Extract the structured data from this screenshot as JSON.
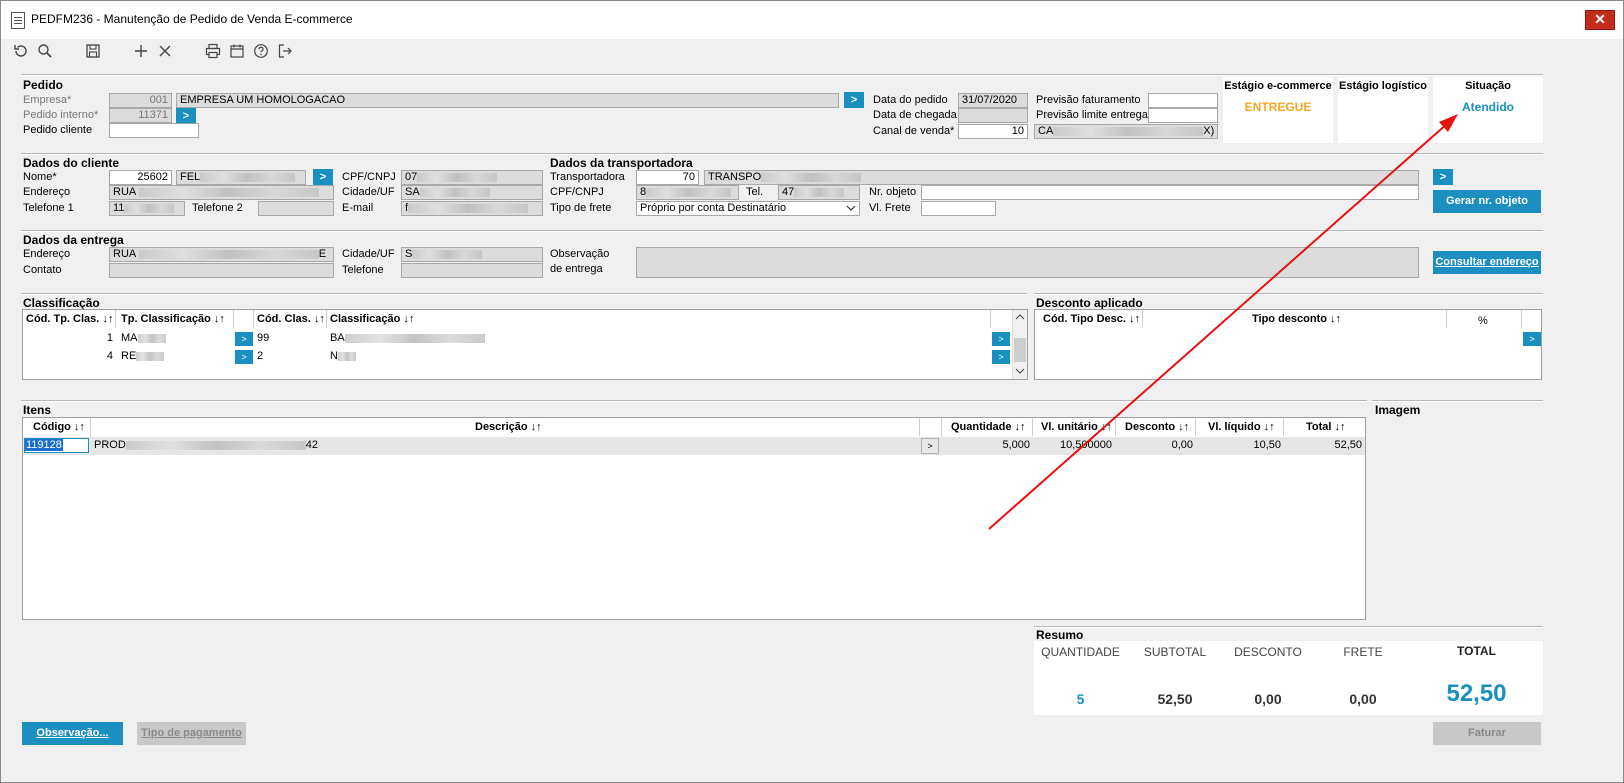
{
  "window": {
    "title": "PEDFM236 - Manutenção de Pedido de Venda E-commerce",
    "close_glyph": "✕"
  },
  "toolbar": {
    "icons": [
      "undo-icon",
      "search-icon",
      "save-icon",
      "add-icon",
      "delete-icon",
      "print-icon",
      "calendar-icon",
      "help-icon",
      "exit-icon"
    ]
  },
  "pedido": {
    "title": "Pedido",
    "empresa_label": "Empresa*",
    "empresa_code": "001",
    "empresa_name": "EMPRESA UM  HOMOLOGACAO",
    "pedido_interno_label": "Pedido interno*",
    "pedido_interno": "11371",
    "pedido_cliente_label": "Pedido cliente",
    "pedido_cliente": "",
    "data_pedido_label": "Data do pedido",
    "data_pedido": "31/07/2020",
    "data_chegada_label": "Data de chegada",
    "data_chegada": "",
    "canal_venda_label": "Canal de venda*",
    "canal_venda_code": "10",
    "canal_venda_name_start": "CA",
    "canal_venda_name_end": "X)",
    "previsao_faturamento_label": "Previsão faturamento",
    "previsao_faturamento": "",
    "previsao_limite_label": "Previsão limite entrega",
    "previsao_limite": ""
  },
  "stages": {
    "ecommerce_label": "Estágio e-commerce",
    "ecommerce_value": "ENTREGUE",
    "logistico_label": "Estágio logístico",
    "logistico_value": "",
    "situacao_label": "Situação",
    "situacao_value": "Atendido"
  },
  "cliente": {
    "title": "Dados do cliente",
    "nome_label": "Nome*",
    "nome_code": "25602",
    "nome_start": "FEL",
    "cpf_label": "CPF/CNPJ",
    "cpf_start": "07",
    "endereco_label": "Endereço",
    "endereco_start": "RUA",
    "cidade_label": "Cidade/UF",
    "cidade_start": "SA",
    "telefone1_label": "Telefone 1",
    "telefone1_start": "11",
    "telefone2_label": "Telefone 2",
    "telefone2": "",
    "email_label": "E-mail",
    "email_start": "f"
  },
  "transportadora": {
    "title": "Dados da transportadora",
    "transportadora_label": "Transportadora",
    "transportadora_code": "70",
    "transportadora_start": "TRANSPO",
    "cpf_label": "CPF/CNPJ",
    "cpf_start": "8",
    "tel_label": "Tel.",
    "tel_start": "47",
    "nr_objeto_label": "Nr. objeto",
    "nr_objeto": "",
    "tipo_frete_label": "Tipo de frete",
    "tipo_frete": "Próprio por conta Destinatário",
    "vl_frete_label": "Vl. Frete",
    "vl_frete": "",
    "gerar_button": "Gerar nr. objeto"
  },
  "entrega": {
    "title": "Dados da entrega",
    "endereco_label": "Endereço",
    "endereco_start": "RUA ",
    "endereco_end": "E",
    "cidade_label": "Cidade/UF",
    "cidade_start": "S",
    "contato_label": "Contato",
    "contato": "",
    "telefone_label": "Telefone",
    "telefone": "",
    "obs_label_1": "Observação",
    "obs_label_2": "de entrega",
    "obs": "",
    "consultar_button": "Consultar endereço"
  },
  "classificacao": {
    "title": "Classificação",
    "headers": [
      "Cód. Tp. Clas. ↓↑",
      "Tp. Classificação ↓↑",
      "Cód. Clas. ↓↑",
      "Classificação ↓↑"
    ],
    "rows": [
      {
        "cod_tp": "1",
        "tp": "MA",
        "cod": "99",
        "clas": "BA"
      },
      {
        "cod_tp": "4",
        "tp": "RE",
        "cod": "2",
        "clas": "N"
      }
    ]
  },
  "desconto": {
    "title": "Desconto aplicado",
    "headers": [
      "Cód. Tipo Desc. ↓↑",
      "Tipo desconto ↓↑",
      "%"
    ]
  },
  "itens": {
    "title": "Itens",
    "imagem_title": "Imagem",
    "headers": [
      "Código ↓↑",
      "Descrição ↓↑",
      "Quantidade ↓↑",
      "Vl. unitário ↓↑",
      "Desconto ↓↑",
      "Vl. líquido ↓↑",
      "Total ↓↑"
    ],
    "rows": [
      {
        "codigo": "119128",
        "descricao_start": "PROD",
        "descricao_end": "42",
        "quantidade": "5,000",
        "vl_unitario": "10,500000",
        "desconto": "0,00",
        "vl_liquido": "10,50",
        "total": "52,50"
      }
    ]
  },
  "resumo": {
    "title": "Resumo",
    "labels": [
      "QUANTIDADE",
      "SUBTOTAL",
      "DESCONTO",
      "FRETE",
      "TOTAL"
    ],
    "quantidade": "5",
    "subtotal": "52,50",
    "desconto": "0,00",
    "frete": "0,00",
    "total": "52,50"
  },
  "buttons": {
    "observacao": "Observação...",
    "tipo_pagamento": "Tipo de pagamento",
    "faturar": "Faturar"
  },
  "colors": {
    "accent": "#1a8fc0",
    "entregue": "#f5a623",
    "atendido": "#1a8fc0",
    "annotation": "#e81010"
  }
}
